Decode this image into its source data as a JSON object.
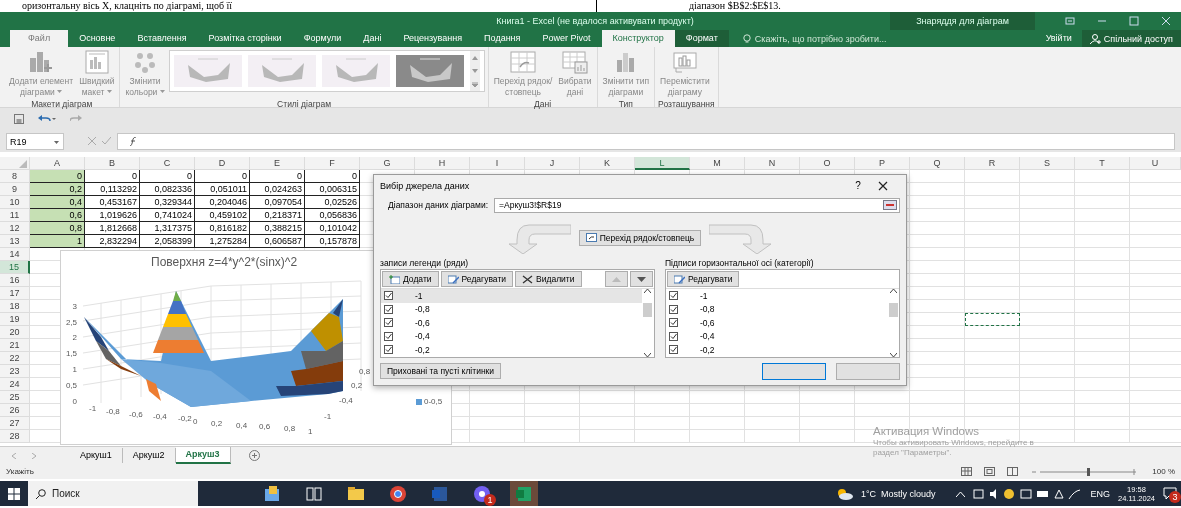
{
  "document_strip": {
    "left_text": "оризонтальну вісь Х, клацніть по діаграмі, щоб її",
    "right_text": "діапазон $B$2:$E$13."
  },
  "window": {
    "title": "Книга1 - Excel (не вдалося активувати продукт)",
    "context_group": "Знаряддя для діаграм"
  },
  "ribbon_tabs": [
    {
      "label": "Файл",
      "kind": "file",
      "selected": false
    },
    {
      "label": "Основне",
      "kind": "tab",
      "selected": false
    },
    {
      "label": "Вставлення",
      "kind": "tab",
      "selected": false
    },
    {
      "label": "Розмітка сторінки",
      "kind": "tab",
      "selected": false
    },
    {
      "label": "Формули",
      "kind": "tab",
      "selected": false
    },
    {
      "label": "Дані",
      "kind": "tab",
      "selected": false
    },
    {
      "label": "Рецензування",
      "kind": "tab",
      "selected": false
    },
    {
      "label": "Подання",
      "kind": "tab",
      "selected": false
    },
    {
      "label": "Power Pivot",
      "kind": "tab",
      "selected": false
    },
    {
      "label": "Конструктор",
      "kind": "context",
      "selected": true
    },
    {
      "label": "Формат",
      "kind": "context",
      "selected": false
    }
  ],
  "tell_me": "Скажіть, що потрібно зробити...",
  "sign_in": "Увійти",
  "share": "Спільний доступ",
  "ribbon_groups": [
    {
      "label": "Макети діаграм",
      "items": [
        {
          "kind": "add-element",
          "label": "Додати елемент\nдіаграми",
          "dropdown": true
        },
        {
          "kind": "quick-layout",
          "label": "Швидкий\nмакет",
          "dropdown": true
        }
      ]
    },
    {
      "label": "Стилі діаграм",
      "items": [
        {
          "kind": "colors",
          "label": "Змінити\nкольори",
          "dropdown": true
        },
        {
          "kind": "gallery",
          "styles": [
            {
              "kind": "light"
            },
            {
              "kind": "light"
            },
            {
              "kind": "light"
            },
            {
              "kind": "dark"
            }
          ]
        }
      ]
    },
    {
      "label": "Дані",
      "items": [
        {
          "kind": "switch",
          "label": "Перехід рядок/\nстовпець",
          "dropdown": false
        },
        {
          "kind": "select-data",
          "label": "Вибрати\nдані",
          "dropdown": false
        }
      ]
    },
    {
      "label": "Тип",
      "items": [
        {
          "kind": "change-type",
          "label": "Змінити тип\nдіаграми",
          "dropdown": false
        }
      ]
    },
    {
      "label": "Розташування",
      "items": [
        {
          "kind": "move",
          "label": "Перемістити\nдіаграму",
          "dropdown": false
        }
      ]
    }
  ],
  "name_box": "R19",
  "columns": [
    {
      "label": "A",
      "selected": false
    },
    {
      "label": "B",
      "selected": false
    },
    {
      "label": "C",
      "selected": false
    },
    {
      "label": "D",
      "selected": false
    },
    {
      "label": "E",
      "selected": false
    },
    {
      "label": "F",
      "selected": false
    },
    {
      "label": "G",
      "selected": false
    },
    {
      "label": "H",
      "selected": false
    },
    {
      "label": "I",
      "selected": false
    },
    {
      "label": "J",
      "selected": false
    },
    {
      "label": "K",
      "selected": false
    },
    {
      "label": "L",
      "selected": true
    },
    {
      "label": "M",
      "selected": false
    },
    {
      "label": "N",
      "selected": false
    },
    {
      "label": "O",
      "selected": false
    },
    {
      "label": "P",
      "selected": false
    },
    {
      "label": "Q",
      "selected": false
    },
    {
      "label": "R",
      "selected": false,
      "marquee": true
    },
    {
      "label": "S",
      "selected": false
    },
    {
      "label": "T",
      "selected": false
    },
    {
      "label": "U",
      "selected": false
    }
  ],
  "rows": [
    {
      "label": "8",
      "selected": false,
      "key_highlighted": true,
      "cells": [
        "0",
        "0",
        "0",
        "0",
        "0",
        "0"
      ]
    },
    {
      "label": "9",
      "selected": false,
      "key_highlighted": true,
      "cells": [
        "0,2",
        "0,113292",
        "0,082336",
        "0,051011",
        "0,024263",
        "0,006315"
      ]
    },
    {
      "label": "10",
      "selected": false,
      "key_highlighted": true,
      "cells": [
        "0,4",
        "0,453167",
        "0,329344",
        "0,204046",
        "0,097054",
        "0,02526"
      ]
    },
    {
      "label": "11",
      "selected": false,
      "key_highlighted": true,
      "cells": [
        "0,6",
        "1,019626",
        "0,741024",
        "0,459102",
        "0,218371",
        "0,056836"
      ]
    },
    {
      "label": "12",
      "selected": false,
      "key_highlighted": true,
      "cells": [
        "0,8",
        "1,812668",
        "1,317375",
        "0,816182",
        "0,388215",
        "0,101042"
      ]
    },
    {
      "label": "13",
      "selected": false,
      "key_highlighted": true,
      "cells": [
        "1",
        "2,832294",
        "2,058399",
        "1,275284",
        "0,606587",
        "0,157878"
      ]
    },
    {
      "label": "14",
      "selected": false
    },
    {
      "label": "15",
      "selected": true
    },
    {
      "label": "16",
      "selected": false
    },
    {
      "label": "17",
      "selected": false
    },
    {
      "label": "18",
      "selected": false
    },
    {
      "label": "19",
      "selected": false,
      "marquee": true
    },
    {
      "label": "20",
      "selected": false
    },
    {
      "label": "21",
      "selected": false
    },
    {
      "label": "22",
      "selected": false
    },
    {
      "label": "23",
      "selected": false
    },
    {
      "label": "24",
      "selected": false
    },
    {
      "label": "25",
      "selected": false
    },
    {
      "label": "26",
      "selected": false
    },
    {
      "label": "27",
      "selected": false
    },
    {
      "label": "28",
      "selected": false
    }
  ],
  "chart": {
    "title": "Поверхня z=4*y^2*(sinx)^2",
    "z_ticks": [
      "3",
      "2,5",
      "2",
      "1,5",
      "1",
      "0,5",
      "0"
    ],
    "x_ticks": [
      "-1",
      "-0,8",
      "-0,6",
      "-0,4",
      "-0,2",
      "0",
      "0,2",
      "0,4",
      "0,6",
      "0,8",
      "1"
    ],
    "y_ticks": [
      "0,8",
      "0,2",
      "-0,4",
      "-1"
    ],
    "legend": [
      {
        "label": "0-0,5",
        "color": "#5b9bd5"
      }
    ]
  },
  "dialog": {
    "title": "Вибір джерела даних",
    "help": "?",
    "range_label": "Діапазон даних діаграми:",
    "range_value": "=Аркуш3!$R$19",
    "switch_button": "Перехід рядок/стовпець",
    "legend_heading": "записи легенди (ряди)",
    "legend_buttons": [
      {
        "kind": "add",
        "label": "Додати"
      },
      {
        "kind": "edit",
        "label": "Редагувати"
      },
      {
        "kind": "delete",
        "label": "Видалити"
      }
    ],
    "legend_items": [
      {
        "label": "-1",
        "checked": true,
        "selected": true
      },
      {
        "label": "-0,8",
        "checked": true,
        "selected": false
      },
      {
        "label": "-0,6",
        "checked": true,
        "selected": false
      },
      {
        "label": "-0,4",
        "checked": true,
        "selected": false
      },
      {
        "label": "-0,2",
        "checked": true,
        "selected": false
      }
    ],
    "axis_heading": "Підписи горизонтальної осі (категорії)",
    "axis_button": "Редагувати",
    "axis_items": [
      {
        "label": "-1",
        "checked": true
      },
      {
        "label": "-0,8",
        "checked": true
      },
      {
        "label": "-0,6",
        "checked": true
      },
      {
        "label": "-0,4",
        "checked": true
      },
      {
        "label": "-0,2",
        "checked": true
      }
    ],
    "hidden_cells_button": "Приховані та пусті клітинки"
  },
  "sheet_tabs": [
    {
      "label": "Аркуш1",
      "selected": false
    },
    {
      "label": "Аркуш2",
      "selected": false
    },
    {
      "label": "Аркуш3",
      "selected": true
    }
  ],
  "status_bar": {
    "text": "Укажіть",
    "zoom": "100 %",
    "zoom_slider": {
      "level": 0.5
    }
  },
  "activation": {
    "title": "Активация Windows",
    "line1": "Чтобы активировать Windows, перейдите в",
    "line2": "раздел \"Параметры\"."
  },
  "taskbar": {
    "search_placeholder": "Поиск",
    "apps": [
      {
        "kind": "widgets",
        "selected": false
      },
      {
        "kind": "taskview",
        "selected": false
      },
      {
        "kind": "explorer",
        "selected": false
      },
      {
        "kind": "browser",
        "selected": false
      },
      {
        "kind": "word",
        "selected": false
      },
      {
        "kind": "messenger",
        "selected": false,
        "badge": "1"
      },
      {
        "kind": "excel",
        "selected": true
      }
    ],
    "weather": "1°C  Mostly cloudy",
    "language": "ENG",
    "time": "19:58",
    "date": "24.11.2024",
    "notifications": "3"
  }
}
